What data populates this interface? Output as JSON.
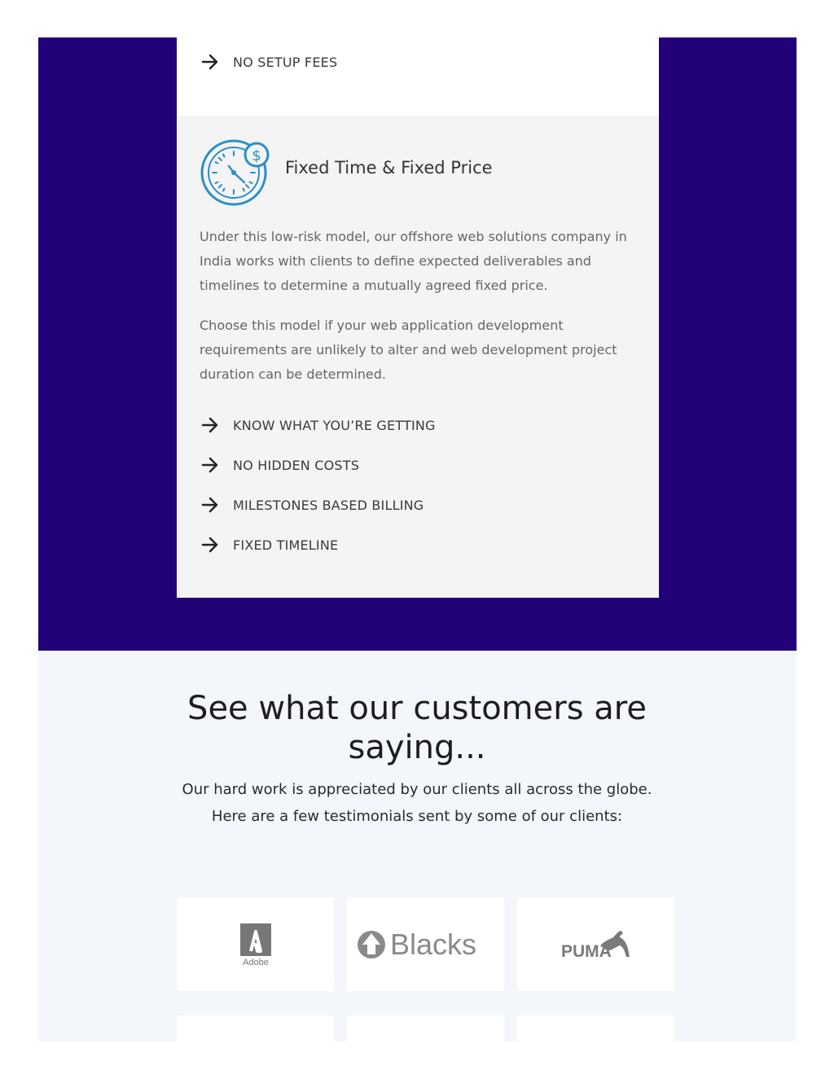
{
  "top_card": {
    "features": [
      "NO SETUP FEES"
    ]
  },
  "pricing_card": {
    "icon": "stopwatch-dollar-icon",
    "title": "Fixed Time & Fixed Price",
    "paragraphs": [
      "Under this low-risk model, our offshore web solutions company in India works with clients to define expected deliverables and timelines to determine a mutually agreed fixed price.",
      "Choose this model if your web application development requirements are unlikely to alter and web development project duration can be determined."
    ],
    "features": [
      "KNOW WHAT YOU’RE GETTING",
      "NO HIDDEN COSTS",
      "MILESTONES BASED BILLING",
      "FIXED TIMELINE"
    ]
  },
  "testimonials": {
    "heading": "See what our customers are saying...",
    "sub_line1": "Our hard work is appreciated by our clients all across the globe.",
    "sub_line2": "Here are a few testimonials sent by some of our clients:",
    "logos": [
      {
        "name": "Adobe",
        "icon": "adobe-logo"
      },
      {
        "name": "Blacks",
        "icon": "blacks-logo"
      },
      {
        "name": "PUMA",
        "icon": "puma-logo"
      }
    ]
  },
  "colors": {
    "band": "#230179",
    "icon_blue": "#2a8fc7",
    "lower_bg": "#f3f7fb"
  }
}
